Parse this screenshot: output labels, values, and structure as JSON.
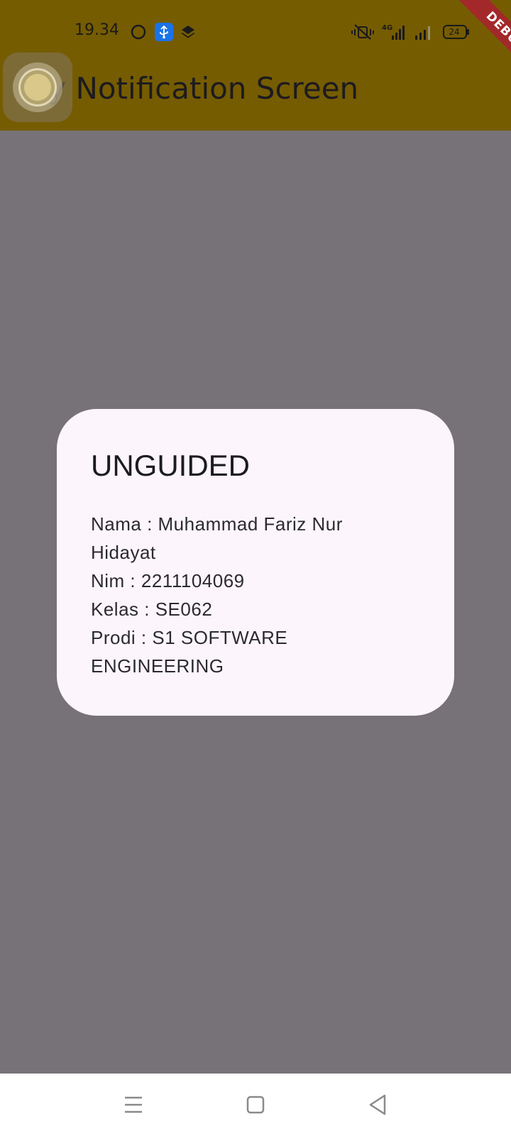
{
  "status_bar": {
    "time": "19.34",
    "network_type": "4G",
    "battery_level": "24",
    "icons": [
      "circle-icon",
      "usb-debug-icon",
      "layers-icon",
      "vibrate-mute-icon",
      "signal-4g-icon",
      "signal-icon",
      "battery-icon"
    ]
  },
  "debug_banner": {
    "label": "DEBUG"
  },
  "app_bar": {
    "title": "My Notification Screen"
  },
  "dialog": {
    "title": "UNGUIDED",
    "lines": [
      "Nama : Muhammad Fariz Nur Hidayat",
      "Nim : 2211104069",
      "Kelas : SE062",
      "Prodi : S1 SOFTWARE ENGINEERING"
    ]
  },
  "navigation_bar": {
    "buttons": [
      "menu-icon",
      "home-icon",
      "back-icon"
    ]
  },
  "colors": {
    "app_bar": "#765c00",
    "scrim_background": "#777278",
    "dialog_background": "#fcf5fc",
    "debug_banner": "#a3282a",
    "usb_icon_badge": "#1a73e8",
    "nav_bar": "#ffffff"
  }
}
